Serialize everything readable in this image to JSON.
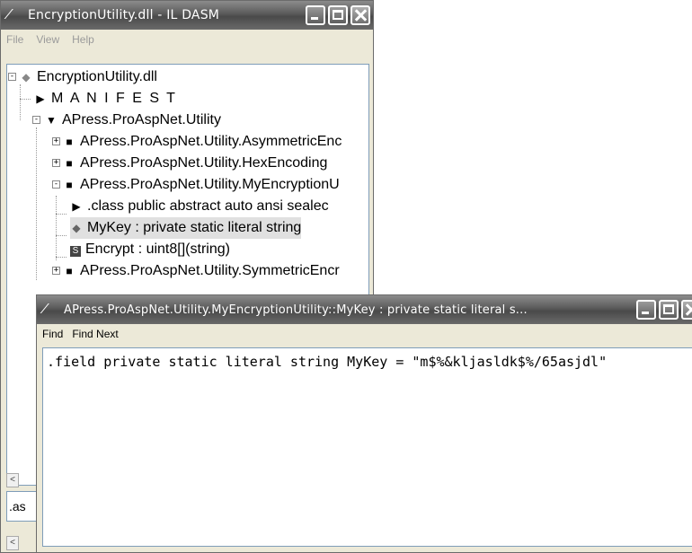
{
  "main_window": {
    "title": "EncryptionUtility.dll - IL DASM",
    "menu": {
      "file": "File",
      "view": "View",
      "help": "Help"
    }
  },
  "tree": {
    "root": "EncryptionUtility.dll",
    "manifest": "M A N I F E S T",
    "namespace": "APress.ProAspNet.Utility",
    "types": [
      "APress.ProAspNet.Utility.AsymmetricEnc",
      "APress.ProAspNet.Utility.HexEncoding",
      "APress.ProAspNet.Utility.MyEncryptionU"
    ],
    "members": [
      ".class public abstract auto ansi sealec",
      "MyKey : private static literal string",
      "Encrypt : uint8[](string)"
    ],
    "last_type": "APress.ProAspNet.Utility.SymmetricEncr"
  },
  "lower_pane_text": ".as",
  "detail_window": {
    "title": "APress.ProAspNet.Utility.MyEncryptionUtility::MyKey : private static literal s...",
    "menu": {
      "find": "Find",
      "find_next": "Find Next"
    },
    "code": ".field private static literal string MyKey = \"m$%&kljasldk$%/65asjdl\""
  },
  "icons": {
    "app": "feather-icon",
    "dll": "diamond-icon",
    "manifest": "triangle-right-icon",
    "namespace": "shield-icon",
    "type": "class-icon",
    "field": "static-field-icon",
    "method": "static-method-icon"
  }
}
